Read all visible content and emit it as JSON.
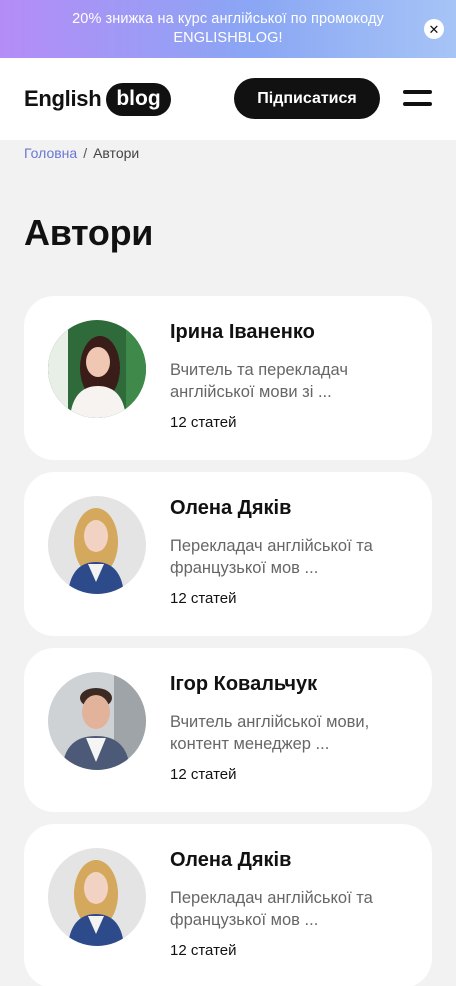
{
  "promo": {
    "text": "20% знижка на курс англійської по промокоду ENGLISHBLOG!",
    "close_icon": "close-icon"
  },
  "header": {
    "logo_text": "English",
    "logo_badge": "blog",
    "subscribe_label": "Підписатися",
    "menu_icon": "hamburger-menu-icon"
  },
  "breadcrumb": {
    "home": "Головна",
    "separator": "/",
    "current": "Автори"
  },
  "page_title": "Автори",
  "authors": [
    {
      "name": "Ірина Іваненко",
      "description": "Вчитель та перекладач англійської мови зі ...",
      "articles": "12 статей"
    },
    {
      "name": "Олена Дяків",
      "description": "Перекладач англійської та французької мов ...",
      "articles": "12 статей"
    },
    {
      "name": "Ігор Ковальчук",
      "description": "Вчитель англійської мови, контент менеджер ...",
      "articles": "12 статей"
    },
    {
      "name": "Олена Дяків",
      "description": "Перекладач англійської та французької мов ...",
      "articles": "12 статей"
    }
  ],
  "colors": {
    "accent_link": "#6a76d4",
    "dark": "#111111",
    "background": "#f2f2f2"
  }
}
